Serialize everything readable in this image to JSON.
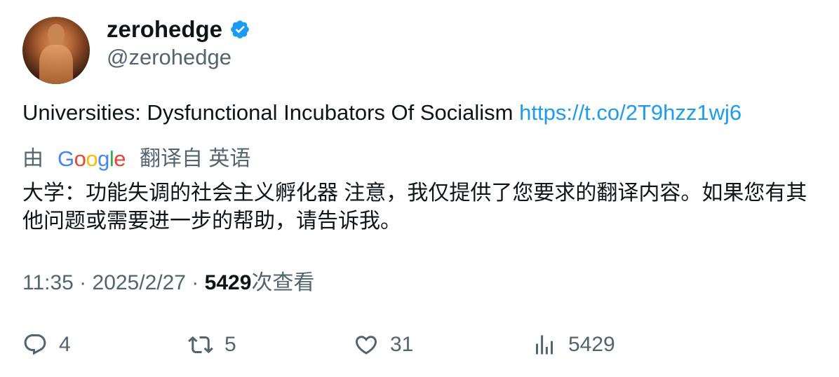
{
  "user": {
    "display_name": "zerohedge",
    "handle": "@zerohedge",
    "verified": true
  },
  "tweet": {
    "text": "Universities: Dysfunctional Incubators Of Socialism ",
    "link": "https://t.co/2T9hzz1wj6"
  },
  "translation": {
    "by": "由",
    "provider": "Google",
    "from_label": "翻译自 英语",
    "text": "大学：功能失调的社会主义孵化器 注意，我仅提供了您要求的翻译内容。如果您有其他问题或需要进一步的帮助，请告诉我。"
  },
  "meta": {
    "time_date": "11:35 · 2025/2/27 · ",
    "views": "5429",
    "views_label": "次查看"
  },
  "actions": {
    "replies": "4",
    "reposts": "5",
    "likes": "31",
    "views": "5429"
  },
  "colors": {
    "link": "#1d9bf0",
    "verified": "#1d9bf0",
    "secondary_text": "#536471",
    "primary_text": "#0f1419"
  }
}
